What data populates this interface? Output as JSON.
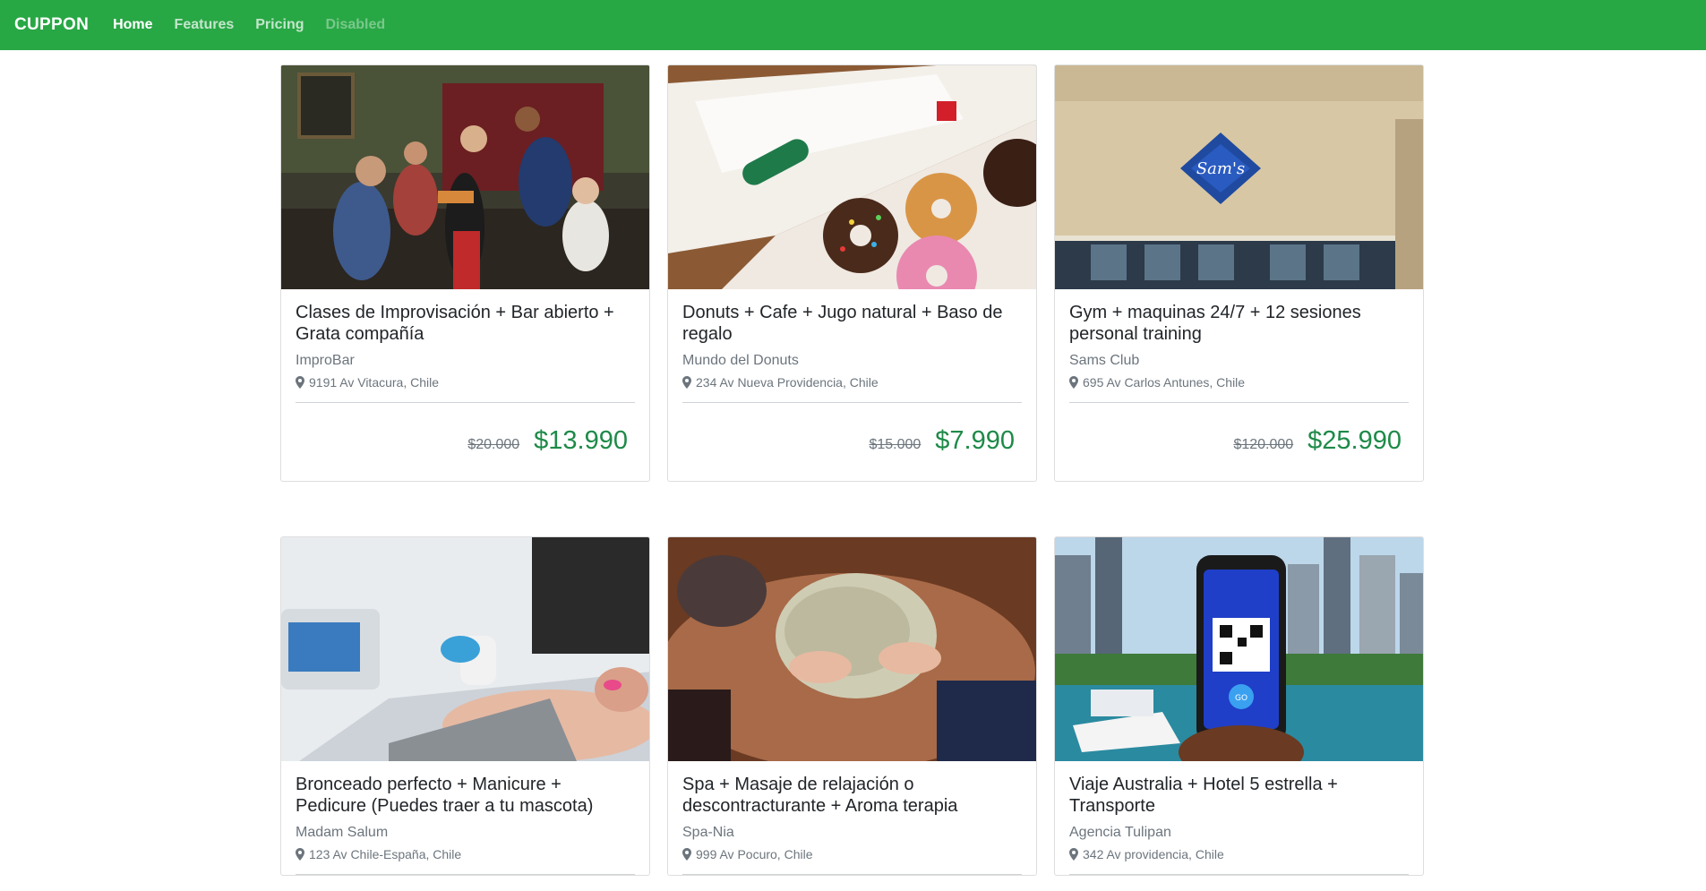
{
  "navbar": {
    "brand": "CUPPON",
    "links": [
      {
        "label": "Home",
        "state": "active"
      },
      {
        "label": "Features",
        "state": "normal"
      },
      {
        "label": "Pricing",
        "state": "normal"
      },
      {
        "label": "Disabled",
        "state": "disabled"
      }
    ]
  },
  "colors": {
    "navbar": "#28a745",
    "price": "#1e8a48"
  },
  "cards": [
    {
      "title": "Clases de Improvisación + Bar abierto + Grata compañía",
      "company": "ImproBar",
      "location": "9191 Av Vitacura, Chile",
      "old_price": "$20.000",
      "new_price": "$13.990",
      "image": "improv-group-photo"
    },
    {
      "title": "Donuts + Cafe + Jugo natural + Baso de regalo",
      "company": "Mundo del Donuts",
      "location": "234 Av Nueva Providencia, Chile",
      "old_price": "$15.000",
      "new_price": "$7.990",
      "image": "donuts-box-photo"
    },
    {
      "title": "Gym + maquinas 24/7 + 12 sesiones personal training",
      "company": "Sams Club",
      "location": "695 Av Carlos Antunes, Chile",
      "old_price": "$120.000",
      "new_price": "$25.990",
      "image": "sams-club-building-photo"
    },
    {
      "title": "Bronceado perfecto + Manicure + Pedicure (Puedes traer a tu mascota)",
      "company": "Madam Salum",
      "location": "123 Av Chile-España, Chile",
      "image": "beauty-treatment-photo"
    },
    {
      "title": "Spa + Masaje de relajación o descontracturante + Aroma terapia",
      "company": "Spa-Nia",
      "location": "999 Av Pocuro, Chile",
      "image": "spa-massage-photo"
    },
    {
      "title": "Viaje Australia + Hotel 5 estrella + Transporte",
      "company": "Agencia Tulipan",
      "location": "342 Av providencia, Chile",
      "image": "city-boat-phone-photo"
    }
  ]
}
